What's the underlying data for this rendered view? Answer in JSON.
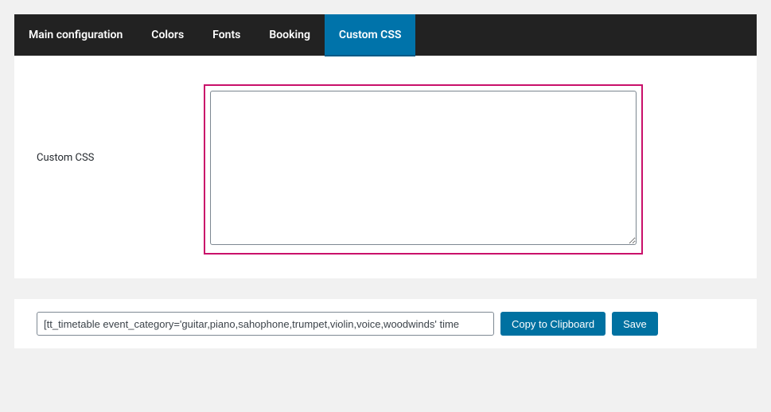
{
  "tabs": {
    "main_configuration": "Main configuration",
    "colors": "Colors",
    "fonts": "Fonts",
    "booking": "Booking",
    "custom_css": "Custom CSS"
  },
  "form": {
    "custom_css_label": "Custom CSS",
    "custom_css_value": ""
  },
  "footer": {
    "shortcode_value": "[tt_timetable event_category='guitar,piano,sahophone,trumpet,violin,voice,woodwinds' time",
    "copy_label": "Copy to Clipboard",
    "save_label": "Save"
  }
}
